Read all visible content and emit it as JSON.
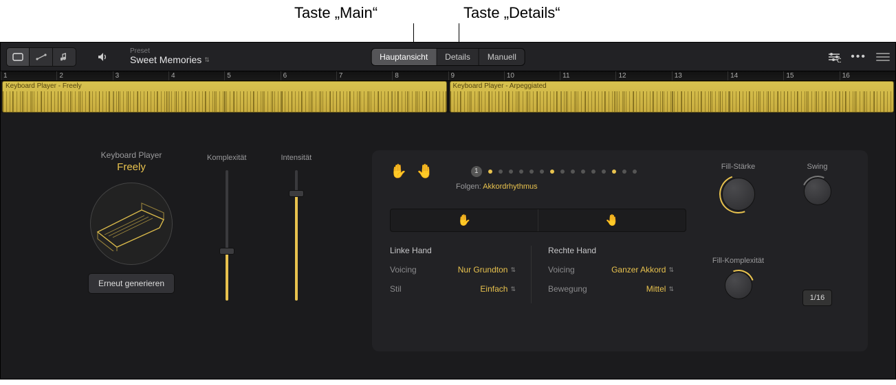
{
  "annotations": {
    "main": "Taste „Main“",
    "details": "Taste „Details“"
  },
  "toolbar": {
    "preset_label": "Preset",
    "preset_name": "Sweet Memories",
    "tabs": {
      "main": "Hauptansicht",
      "details": "Details",
      "manual": "Manuell"
    }
  },
  "ruler": [
    "1",
    "2",
    "3",
    "4",
    "5",
    "6",
    "7",
    "8",
    "9",
    "10",
    "11",
    "12",
    "13",
    "14",
    "15",
    "16"
  ],
  "regions": {
    "a": "Keyboard Player - Freely",
    "b": "Keyboard Player - Arpeggiated"
  },
  "player": {
    "type_label": "Keyboard Player",
    "name": "Freely",
    "regen": "Erneut generieren"
  },
  "sliders": {
    "complexity": "Komplexität",
    "intensity": "Intensität"
  },
  "beats": {
    "one": "1",
    "follow_key": "Folgen:",
    "follow_val": "Akkordrhythmus"
  },
  "hands": {
    "left_title": "Linke Hand",
    "right_title": "Rechte Hand",
    "voicing_key": "Voicing",
    "style_key": "Stil",
    "movement_key": "Bewegung",
    "left_voicing": "Nur Grundton",
    "left_style": "Einfach",
    "right_voicing": "Ganzer Akkord",
    "right_movement": "Mittel"
  },
  "knobs": {
    "fill_strength": "Fill-Stärke",
    "swing": "Swing",
    "fill_complexity": "Fill-Komplexität",
    "swing_value": "1/16"
  }
}
